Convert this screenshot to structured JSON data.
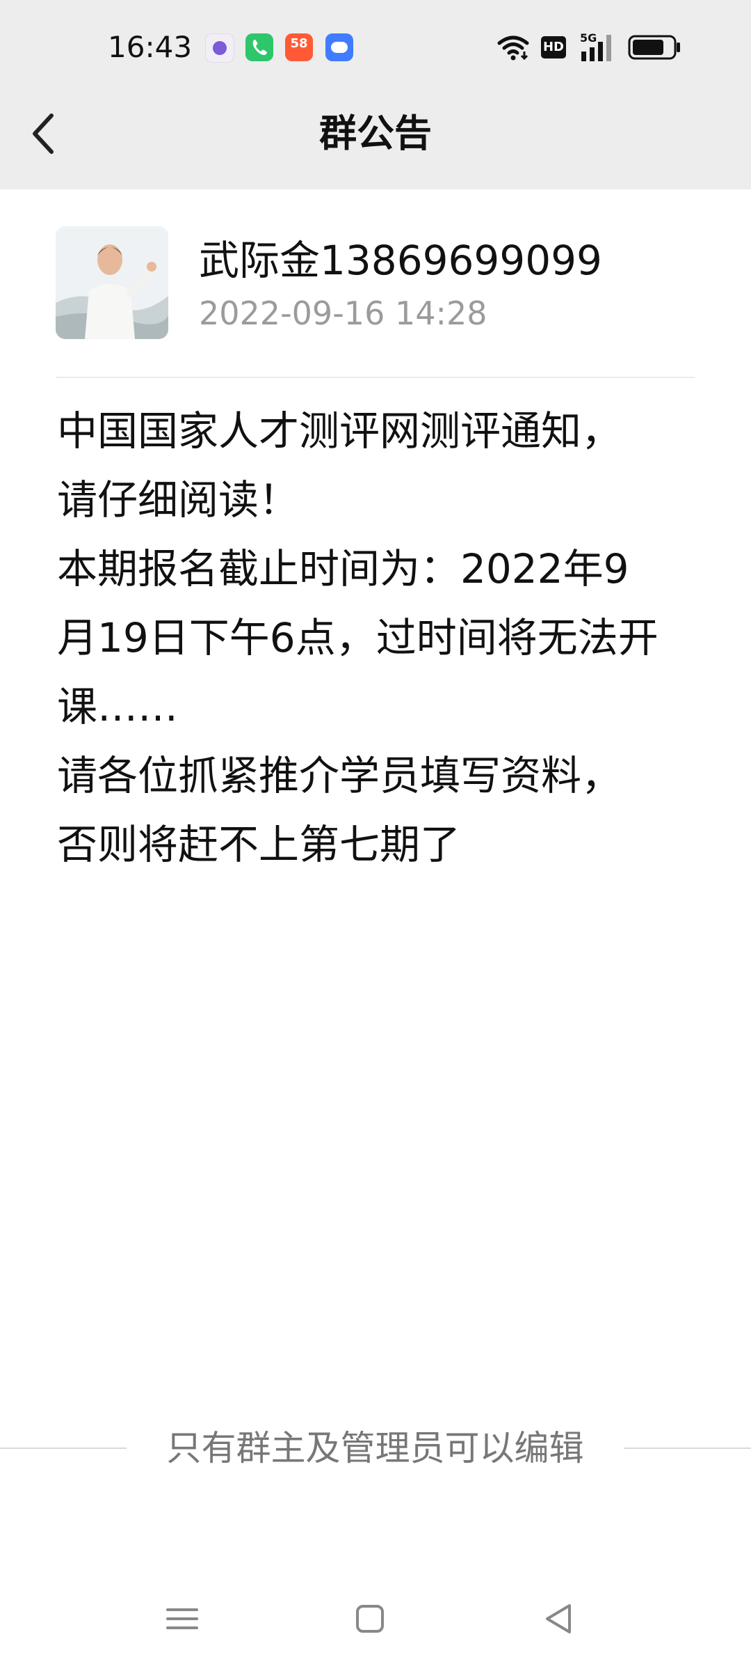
{
  "status_bar": {
    "time": "16:43",
    "app_icons": [
      "purple-app-icon",
      "phone-app-icon",
      "58-app-icon",
      "cloud-app-icon"
    ],
    "icons": [
      "wifi-icon",
      "hd-icon",
      "5g-signal-icon",
      "battery-icon"
    ],
    "hd_label": "HD"
  },
  "header": {
    "title": "群公告",
    "back_icon": "chevron-left-icon"
  },
  "post": {
    "author": "武际金13869699099",
    "time": "2022-09-16 14:28",
    "lines": [
      "中国国家人才测评网测评通知，",
      "请仔细阅读！",
      "本期报名截止时间为：2022年9",
      "月19日下午6点，过时间将无法开",
      "课……",
      "请各位抓紧推介学员填写资料，",
      "否则将赶不上第七期了"
    ]
  },
  "footer": {
    "note": "只有群主及管理员可以编辑"
  },
  "nav": {
    "icons": [
      "menu-icon",
      "home-icon",
      "back-icon"
    ]
  },
  "colors": {
    "header_bg": "#ededed",
    "page_bg": "#ffffff",
    "meta_text": "#9b9b9b",
    "footer_text": "#777777"
  }
}
